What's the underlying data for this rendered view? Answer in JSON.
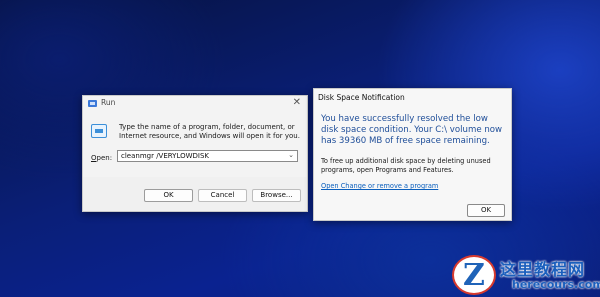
{
  "run_dialog": {
    "title": "Run",
    "close_glyph": "✕",
    "description": "Type the name of a program, folder, document, or Internet resource, and Windows will open it for you.",
    "open_label_accel": "O",
    "open_label_rest": "pen:",
    "command_value": "cleanmgr /VERYLOWDISK",
    "buttons": {
      "ok": "OK",
      "cancel": "Cancel",
      "browse": "Browse..."
    }
  },
  "disk_dialog": {
    "title": "Disk Space Notification",
    "headline": "You have successfully resolved the low disk space condition. Your C:\\ volume now has 39360 MB of free space remaining.",
    "body": "To free up additional disk space by deleting unused programs, open Programs and Features.",
    "link": "Open Change or remove a program",
    "ok_label": "OK",
    "colors": {
      "headline": "#1f4e99",
      "link": "#0b5fbd"
    }
  },
  "watermark": {
    "cn_text": "这里教程网",
    "en_text": "herecours.com"
  }
}
